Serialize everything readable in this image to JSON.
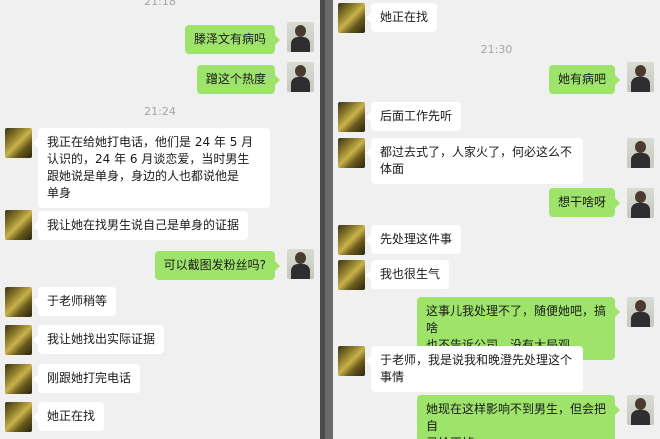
{
  "left": {
    "timestamps": [
      "21:18",
      "21:24"
    ],
    "messages": [
      {
        "side": "right",
        "text": "滕泽文有病吗"
      },
      {
        "side": "right",
        "text": "蹭这个热度"
      },
      {
        "side": "left",
        "text": "我正在给她打电话，他们是 24 年 5 月\n认识的，24 年 6 月谈恋爱，当时男生\n跟她说是单身，身边的人也都说他是\n单身"
      },
      {
        "side": "left",
        "text": "我让她在找男生说自己是单身的证据"
      },
      {
        "side": "right",
        "text": "可以截图发粉丝吗?"
      },
      {
        "side": "left",
        "text": "于老师稍等"
      },
      {
        "side": "left",
        "text": "我让她找出实际证据"
      },
      {
        "side": "left",
        "text": "刚跟她打完电话"
      },
      {
        "side": "left",
        "text": "她正在找"
      }
    ]
  },
  "right": {
    "timestamps": [
      "21:30"
    ],
    "messages": [
      {
        "side": "left",
        "text": "她正在找"
      },
      {
        "side": "right",
        "text": "她有病吧"
      },
      {
        "side": "left",
        "text": "后面工作先听"
      },
      {
        "side": "left",
        "text": "都过去式了，人家火了，何必这么不\n体面"
      },
      {
        "side": "right",
        "text": "想干啥呀"
      },
      {
        "side": "left",
        "text": "先处理这件事"
      },
      {
        "side": "left",
        "text": "我也很生气"
      },
      {
        "side": "right",
        "text": "这事儿我处理不了，随便她吧，搞啥\n也不告诉公司，没有大局观"
      },
      {
        "side": "left",
        "text": "于老师，我是说我和晚澄先处理这个\n事情"
      },
      {
        "side": "right",
        "text": "她现在这样影响不到男生，但会把自\n己给灭掉"
      }
    ]
  },
  "colors": {
    "sent_bubble": "#9ee36a",
    "received_bubble": "#ffffff",
    "background": "#f0f0f0"
  }
}
